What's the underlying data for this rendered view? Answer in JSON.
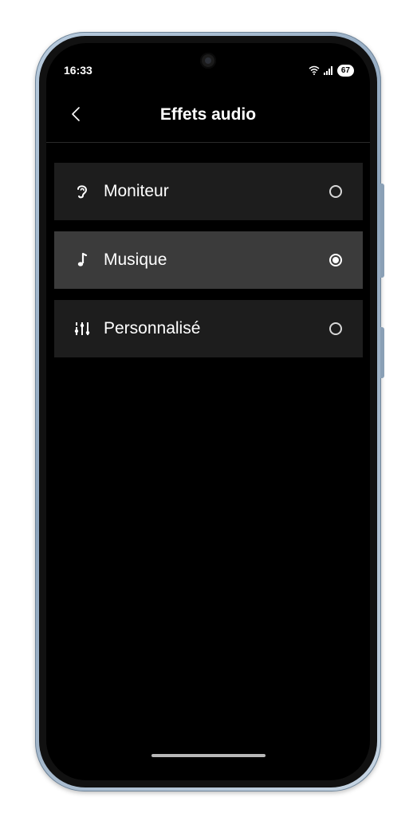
{
  "status_bar": {
    "time": "16:33",
    "battery": "67"
  },
  "header": {
    "title": "Effets audio"
  },
  "options": [
    {
      "label": "Moniteur",
      "icon": "ear-icon",
      "selected": false
    },
    {
      "label": "Musique",
      "icon": "music-note-icon",
      "selected": true
    },
    {
      "label": "Personnalisé",
      "icon": "equalizer-icon",
      "selected": false
    }
  ],
  "colors": {
    "background": "#000000",
    "row": "#1d1d1d",
    "row_selected": "#3b3b3b",
    "text": "#ffffff"
  }
}
